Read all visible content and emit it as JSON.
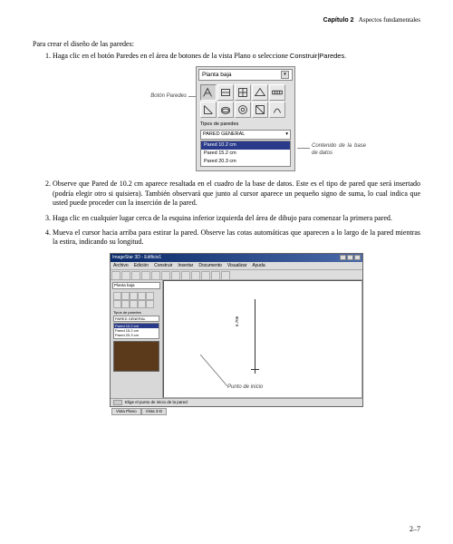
{
  "header": {
    "chapter_label": "Capítulo 2",
    "chapter_title": "Aspectos fundamentales"
  },
  "intro": "Para crear el diseño de las paredes:",
  "steps": [
    {
      "text_a": "Haga clic en el botón Paredes en el área de botones de la vista Plano o seleccione ",
      "menu": "Construir|Paredes."
    },
    {
      "text_a": "Observe que Pared de 10.2 cm aparece resaltada en el cuadro de la base de datos. Este es el tipo de pared que será insertado (podría elegir otro si quisiera). También observará que junto al cursor aparece un pequeño signo de suma, lo cual indica que usted puede proceder con la inserción de la pared."
    },
    {
      "text_a": "Haga clic en cualquier lugar cerca de la esquina inferior izquierda del área de dibujo para comenzar la primera pared."
    },
    {
      "text_a": "Mueva el cursor hacia arriba para estirar la pared. Observe las cotas automáticas que aparecen a lo largo de la pared mientras la estira, indicando su longitud."
    }
  ],
  "panel": {
    "title": "Planta baja",
    "section_label": "Tipos de paredes",
    "combo": "PARED GENERAL",
    "list": [
      "Pared 10.2 cm",
      "Pared 15.2 cm",
      "Pared 20.3 cm"
    ]
  },
  "callouts": {
    "boton_paredes": "Botón Paredes",
    "contenido": "Contenido de la base de datos",
    "punto_inicio": "Punto de inicio"
  },
  "app": {
    "title": "ImageStar 3D - Edificio1",
    "menus": [
      "Archivo",
      "Edición",
      "Construir",
      "Insertar",
      "Documento",
      "Visualizar",
      "Ayuda"
    ],
    "left_title": "Planta baja",
    "left_section": "Tipos de paredes",
    "left_combo": "PARED GENERAL",
    "left_list": [
      "Pared 10.2 cm",
      "Pared 15.2 cm",
      "Pared 20.3 cm"
    ],
    "dimension": "6.706",
    "tabs": [
      "Vista Plano",
      "Vista 3-D"
    ],
    "status": "Elige el punto de inicio de la pared"
  },
  "page_number": "2–7"
}
